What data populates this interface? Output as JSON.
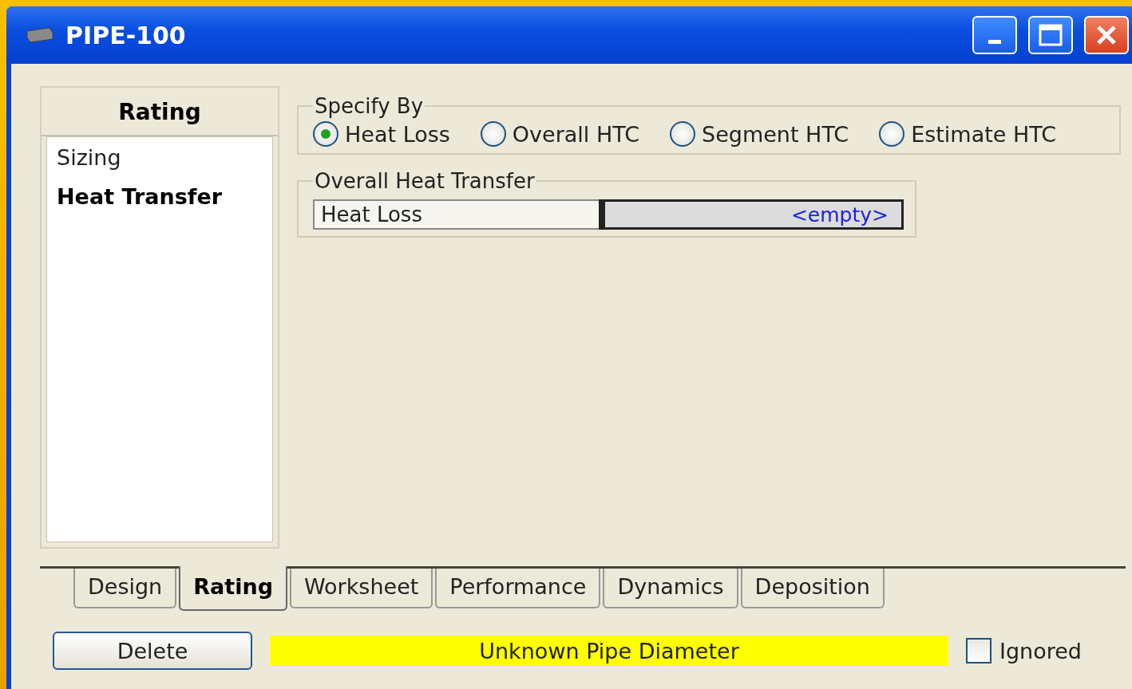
{
  "window": {
    "title": "PIPE-100"
  },
  "side_panel": {
    "title": "Rating",
    "items": [
      {
        "label": "Sizing",
        "selected": false
      },
      {
        "label": "Heat Transfer",
        "selected": true
      }
    ]
  },
  "specify_by": {
    "title": "Specify By",
    "options": [
      {
        "label": "Heat Loss",
        "selected": true
      },
      {
        "label": "Overall HTC",
        "selected": false
      },
      {
        "label": "Segment HTC",
        "selected": false
      },
      {
        "label": "Estimate HTC",
        "selected": false
      }
    ]
  },
  "overall_heat_transfer": {
    "title": "Overall Heat Transfer",
    "rows": [
      {
        "label": "Heat Loss",
        "value": "<empty>"
      }
    ]
  },
  "tabs": [
    {
      "label": "Design",
      "selected": false
    },
    {
      "label": "Rating",
      "selected": true
    },
    {
      "label": "Worksheet",
      "selected": false
    },
    {
      "label": "Performance",
      "selected": false
    },
    {
      "label": "Dynamics",
      "selected": false
    },
    {
      "label": "Deposition",
      "selected": false
    }
  ],
  "delete_button": "Delete",
  "status": "Unknown Pipe Diameter",
  "ignored": {
    "label": "Ignored",
    "checked": false
  }
}
